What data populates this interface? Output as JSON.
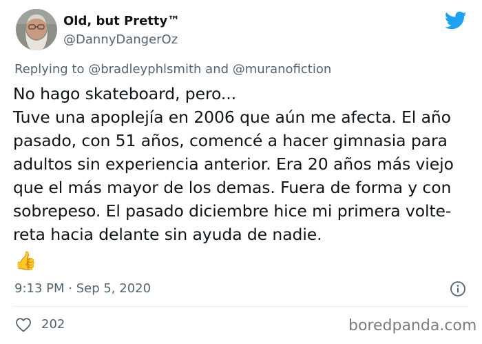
{
  "author": {
    "display_name": "Old, but Pretty™",
    "handle": "@DannyDangerOz"
  },
  "reply": {
    "prefix": "Replying to ",
    "mention_1": "@bradleyphlsmith",
    "conjunction": " and ",
    "mention_2": "@muranofiction"
  },
  "body": "No hago skateboard, pero...\nTuve una apoplejía en 2006 que aún me afecta. El año pasado, con 51 años, comencé a hacer gimnasia para adultos sin experiencia anterior. Era 20 años más viejo que el más mayor de los demas. Fuera de forma y con sobrepeso. El pasado diciembre hice mi primera volte-reta hacia delante sin ayuda de nadie.",
  "emoji": "👍",
  "timestamp": "9:13 PM · Sep 5, 2020",
  "likes": "202",
  "watermark": "boredpanda.com",
  "colors": {
    "twitter_blue": "#1da1f2",
    "secondary_text": "#536471",
    "divider": "#e6ecf0"
  },
  "icons": {
    "logo": "twitter-bird-icon",
    "info": "info-icon",
    "like": "heart-icon"
  }
}
